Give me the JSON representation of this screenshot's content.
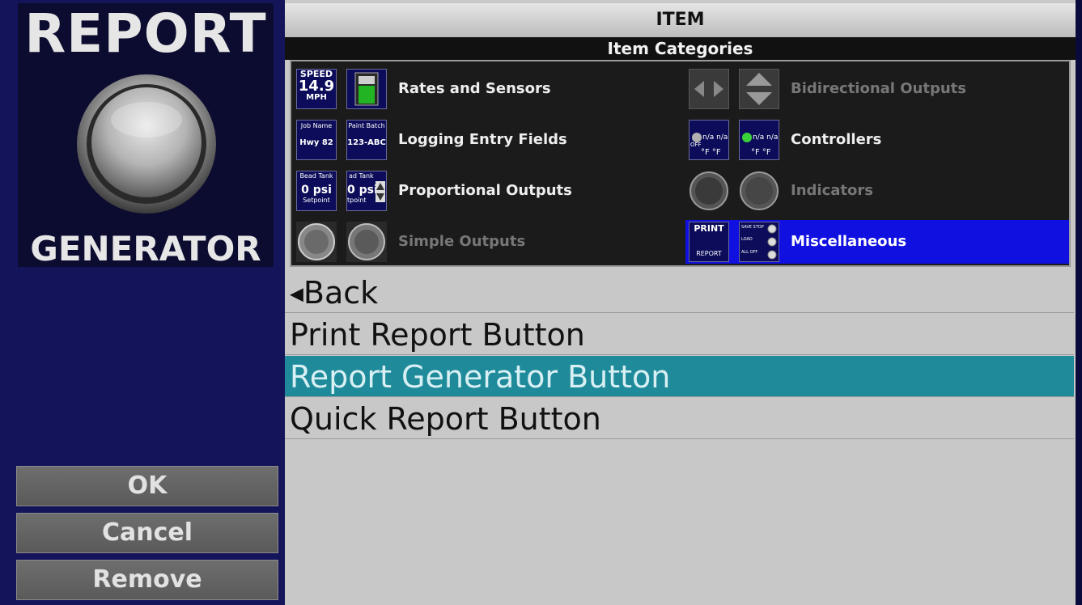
{
  "logo": {
    "line1": "REPORT",
    "line2": "GENERATOR",
    "icon": "round-button-icon"
  },
  "actions": {
    "ok": "OK",
    "cancel": "Cancel",
    "remove": "Remove"
  },
  "header": {
    "title": "ITEM",
    "subtitle": "Item Categories"
  },
  "categories": [
    {
      "label": "Rates and Sensors",
      "enabled": true,
      "selected": false,
      "icon_a": {
        "top": "SPEED",
        "value": "14.9",
        "unit": "MPH"
      }
    },
    {
      "label": "Bidirectional Outputs",
      "enabled": false,
      "selected": false
    },
    {
      "label": "Logging Entry Fields",
      "enabled": true,
      "selected": false,
      "icon_a": {
        "top": "Job Name",
        "value": "Hwy 82"
      },
      "icon_b": {
        "top": "Paint Batch",
        "value": "123-ABC"
      }
    },
    {
      "label": "Controllers",
      "enabled": true,
      "selected": false,
      "icon_a": {
        "value": "n/a n/a",
        "unit": "°F °F",
        "status": "OFF"
      },
      "icon_b": {
        "value": "n/a n/a",
        "unit": "°F °F"
      }
    },
    {
      "label": "Proportional Outputs",
      "enabled": true,
      "selected": false,
      "icon_a": {
        "top": "Bead Tank",
        "value": "0 psi",
        "unit": "Setpoint"
      },
      "icon_b": {
        "top": "ad Tank",
        "value": "0 psi",
        "unit": "tpoint"
      }
    },
    {
      "label": "Indicators",
      "enabled": false,
      "selected": false
    },
    {
      "label": "Simple Outputs",
      "enabled": false,
      "selected": false
    },
    {
      "label": "Miscellaneous",
      "enabled": true,
      "selected": true,
      "icon_a": {
        "top": "PRINT",
        "unit": "REPORT"
      },
      "icon_b": {
        "rows": [
          "SAVE STOP",
          "LOAD",
          "ALL OFF"
        ]
      }
    }
  ],
  "list": {
    "back": "Back",
    "back_icon": "triangle-left-icon",
    "items": [
      "Print Report Button",
      "Report Generator Button",
      "Quick Report Button"
    ],
    "selected_index": 1
  },
  "colors": {
    "selected_row": "#1e8a9a",
    "selected_category": "#1010e0",
    "left_panel": "#14145a"
  }
}
